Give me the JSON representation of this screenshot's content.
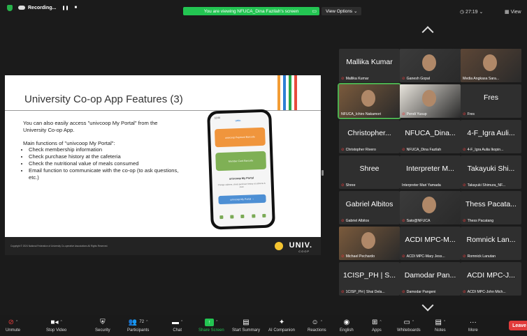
{
  "topbar": {
    "recording_label": "Recording...",
    "pause_symbol": "❚❚",
    "stop_symbol": "■",
    "banner_text": "You are viewing NFUCA_Dina Fazilah's screen",
    "view_options": "View Options ⌄",
    "timer": "◷ 27:19 ⌄",
    "view_label": "View"
  },
  "slide": {
    "title": "University Co-op App Features (3)",
    "para1": "You can also easily access \"univcoop My Portal\" from the University Co-op App.",
    "para2": "Main functions of \"univcoop My Portal\":",
    "bullets": [
      "Check membership information",
      "Check purchase history at the cafeteria",
      "Check the nutritional value of meals consumed",
      "Email function to communicate with the co-op (to ask questions, etc.)"
    ],
    "copyright": "Copyright © 2024 National Federation of University Co-operative Associations All Rights Reserved.",
    "logo_text": "UNIV.",
    "logo_sub": "COOP",
    "stripe_colors": [
      "#f39c34",
      "#2e7fd4",
      "#27a84a",
      "#e84b3c"
    ],
    "phone": {
      "time": "12:00",
      "logo": "univ.",
      "card1": "univcoop Payment Barcode",
      "card2": "Member Card Barcode",
      "portal_title": "univcoop My Portal",
      "portal_small": "Change address, check purchase history at cafeteria & more",
      "portal_btn": "univcoop My Portal  →"
    }
  },
  "gallery": [
    {
      "big": "Mallika Kumar",
      "small": "Mallika Kumar",
      "video": false,
      "muted": true
    },
    {
      "big": "",
      "small": "Ganesh Gopal",
      "video": true,
      "muted": true
    },
    {
      "big": "",
      "small": "Media Angkasa Sara...",
      "video": true,
      "muted": false
    },
    {
      "big": "",
      "small": "NFUCA_Ichiro Nakamori",
      "video": true,
      "muted": false,
      "active": true
    },
    {
      "big": "",
      "small": "Pendi Yusup",
      "video": true,
      "muted": true
    },
    {
      "big": "Fres",
      "small": "Fres",
      "video": false,
      "muted": true
    },
    {
      "big": "Christopher...",
      "small": "Christopher Rivero",
      "video": false,
      "muted": true
    },
    {
      "big": "NFUCA_Dina...",
      "small": "NFUCA_Dina Fazilah",
      "video": false,
      "muted": true
    },
    {
      "big": "4-F_Igra Auli...",
      "small": "4-F_Igra Aulia Ikopin...",
      "video": false,
      "muted": true
    },
    {
      "big": "Shree",
      "small": "Shree",
      "video": false,
      "muted": true
    },
    {
      "big": "Interpreter M...",
      "small": "Interpreter Mari Yamada",
      "video": false,
      "muted": false
    },
    {
      "big": "Takayuki Shi...",
      "small": "Takayuki Shimura_NF...",
      "video": false,
      "muted": true
    },
    {
      "big": "Gabriel Albitos",
      "small": "Gabriel Albitos",
      "video": false,
      "muted": true
    },
    {
      "big": "",
      "small": "Sato@NFUCA",
      "video": true,
      "muted": true
    },
    {
      "big": "Thess Pacata...",
      "small": "Thess Pacatang",
      "video": false,
      "muted": true
    },
    {
      "big": "",
      "small": "Michael Pechardo",
      "video": true,
      "muted": true
    },
    {
      "big": "ACDI MPC-M...",
      "small": "ACDI MPC-Mary Jess...",
      "video": false,
      "muted": true
    },
    {
      "big": "Romnick Lan...",
      "small": "Romnick Lanutan",
      "video": false,
      "muted": true
    },
    {
      "big": "1CISP_PH | S...",
      "small": "1CISP_PH | Shai Dela...",
      "video": false,
      "muted": true
    },
    {
      "big": "Damodar Pan...",
      "small": "Damodar Pangeni",
      "video": false,
      "muted": true
    },
    {
      "big": "ACDI MPC-J...",
      "small": "ACDI MPC-John Mich...",
      "video": false,
      "muted": true
    }
  ],
  "toolbar": {
    "unmute": "Unmute",
    "stop_video": "Stop Video",
    "security": "Security",
    "participants": "Participants",
    "participants_count": "72",
    "chat": "Chat",
    "share_screen": "Share Screen",
    "start_summary": "Start Summary",
    "ai_companion": "AI Companion",
    "reactions": "Reactions",
    "english": "English",
    "apps": "Apps",
    "whiteboards": "Whiteboards",
    "notes": "Notes",
    "more": "More",
    "leave": "Leave"
  }
}
